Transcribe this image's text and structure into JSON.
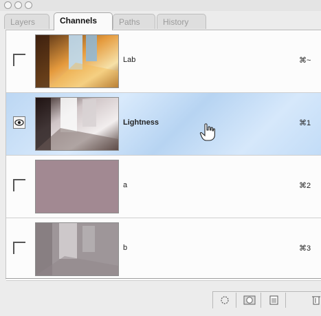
{
  "window": {
    "tabs": [
      {
        "label": "Layers"
      },
      {
        "label": "Channels"
      },
      {
        "label": "Paths"
      },
      {
        "label": "History"
      }
    ],
    "active_tab": "Channels"
  },
  "channels": [
    {
      "name": "Lab",
      "shortcut": "⌘~",
      "visible": false,
      "selected": false,
      "thumbnail": "color-window-scene"
    },
    {
      "name": "Lightness",
      "shortcut": "⌘1",
      "visible": true,
      "selected": true,
      "thumbnail": "grayscale-window-scene"
    },
    {
      "name": "a",
      "shortcut": "⌘2",
      "visible": false,
      "selected": false,
      "thumbnail": "flat-pink-gray"
    },
    {
      "name": "b",
      "shortcut": "⌘3",
      "visible": false,
      "selected": false,
      "thumbnail": "faint-gray-window-scene"
    }
  ],
  "footer": {
    "icons": [
      "load-channel-as-selection-icon",
      "save-selection-as-channel-icon",
      "new-channel-icon",
      "delete-channel-icon"
    ]
  },
  "colors": {
    "selected_row": "#c8def7",
    "panel_background": "#fcfcfc"
  }
}
